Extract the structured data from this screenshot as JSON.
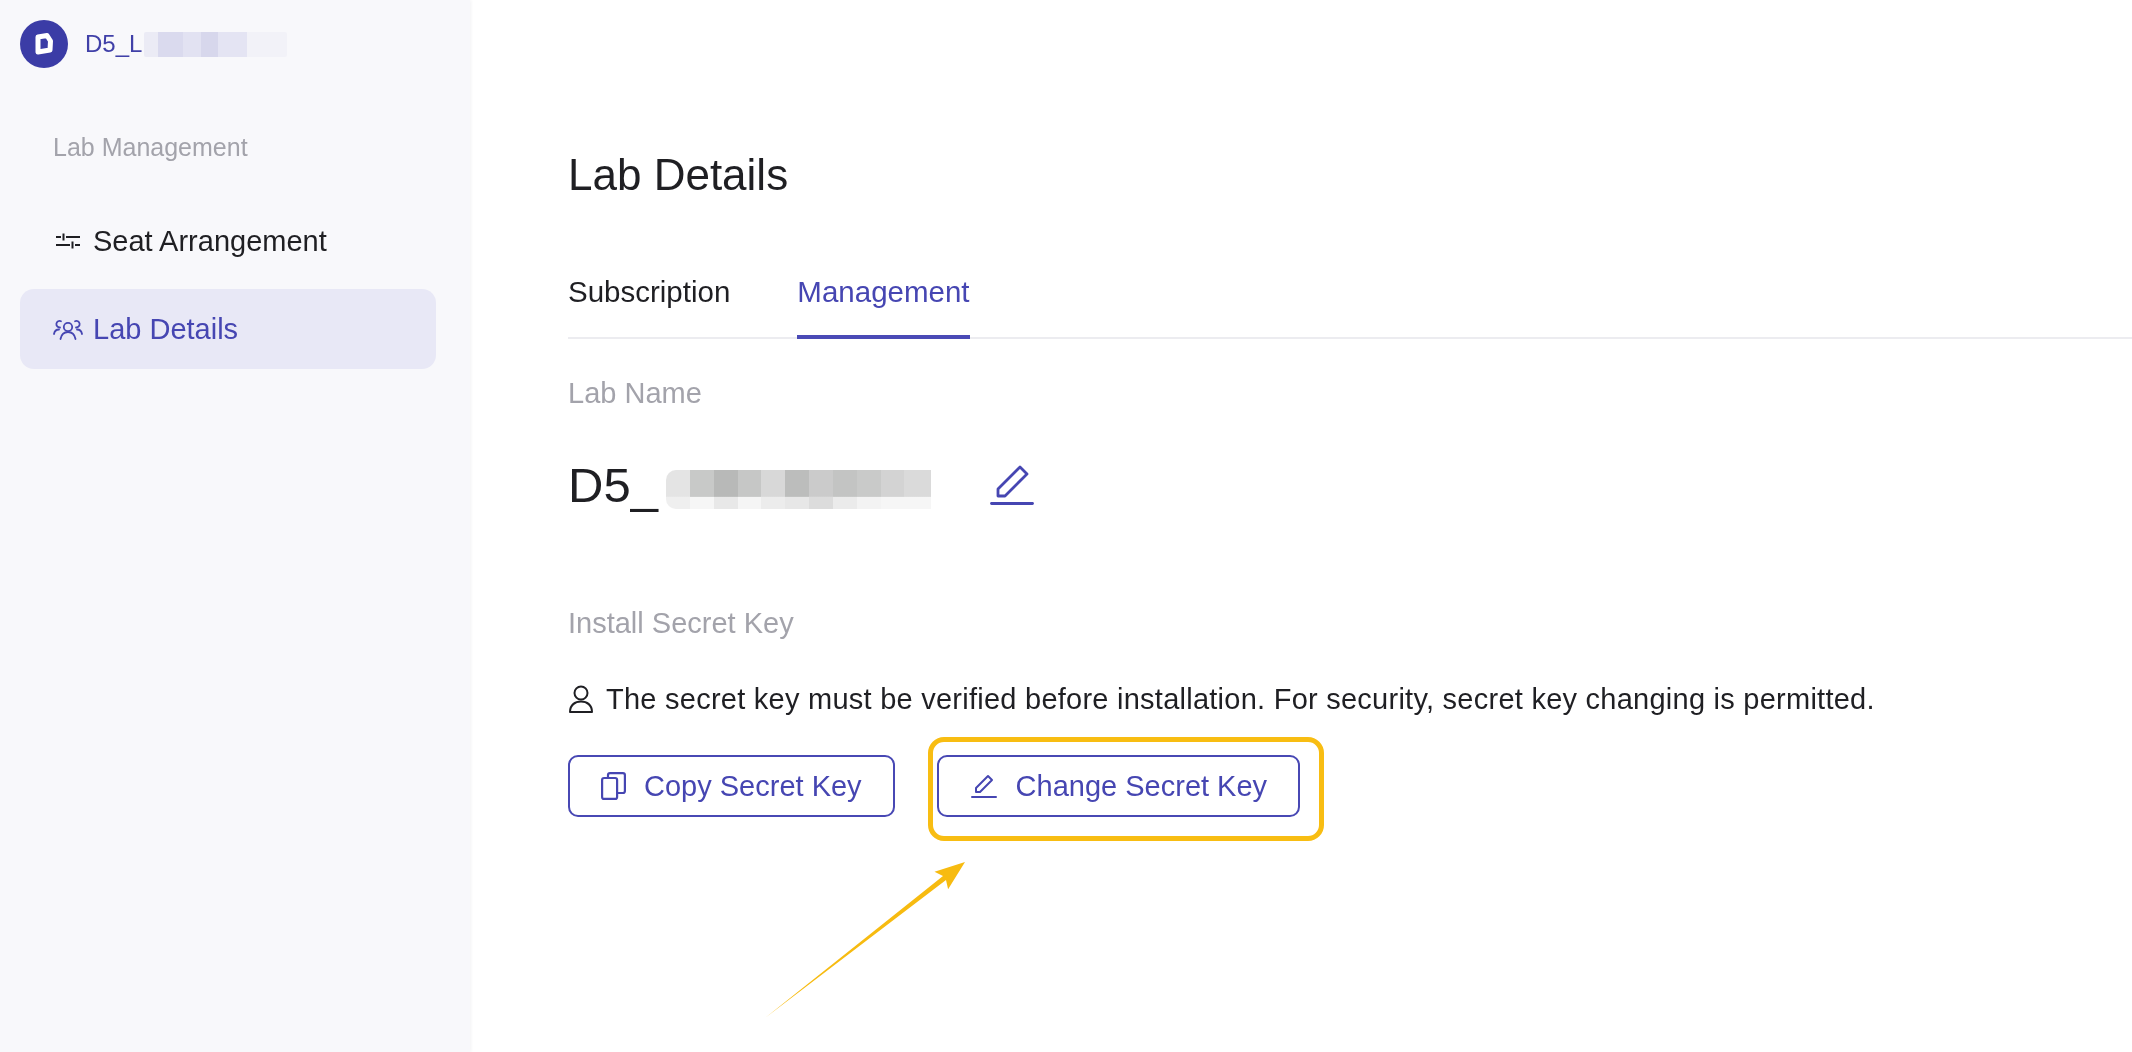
{
  "sidebar": {
    "workspace": {
      "name": "D5_L",
      "redacted": true
    },
    "section_title": "Lab Management",
    "items": [
      {
        "label": "Seat Arrangement",
        "selected": false
      },
      {
        "label": "Lab Details",
        "selected": true
      }
    ]
  },
  "page": {
    "title": "Lab Details",
    "tabs": [
      {
        "label": "Subscription",
        "selected": false
      },
      {
        "label": "Management",
        "selected": true
      }
    ]
  },
  "lab_name": {
    "label": "Lab Name",
    "value": "D5_",
    "redacted": true
  },
  "secret_key": {
    "label": "Install Secret Key",
    "notice": "The secret key must be verified before installation. For security, secret key changing is permitted.",
    "buttons": [
      {
        "label": "Copy Secret Key",
        "highlighted": false
      },
      {
        "label": "Change Secret Key",
        "highlighted": true
      }
    ]
  }
}
